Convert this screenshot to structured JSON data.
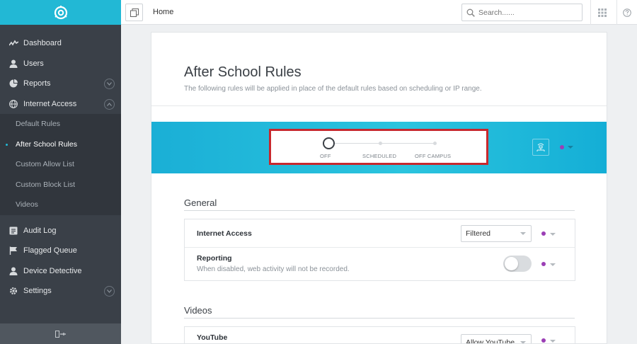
{
  "colors": {
    "brand": "#22b8d5",
    "sidebar": "#3a4048",
    "highlight_border": "#c8282d",
    "policy_dot": "#9b3fb5"
  },
  "sidebar": {
    "items": [
      {
        "label": "Dashboard",
        "icon": "activity-icon"
      },
      {
        "label": "Users",
        "icon": "user-icon"
      },
      {
        "label": "Reports",
        "icon": "pie-chart-icon"
      },
      {
        "label": "Internet Access",
        "icon": "globe-icon"
      }
    ],
    "sub_items": [
      {
        "label": "Default Rules"
      },
      {
        "label": "After School Rules"
      },
      {
        "label": "Custom Allow List"
      },
      {
        "label": "Custom Block List"
      },
      {
        "label": "Videos"
      }
    ],
    "items2": [
      {
        "label": "Audit Log",
        "icon": "list-icon"
      },
      {
        "label": "Flagged Queue",
        "icon": "flag-icon"
      },
      {
        "label": "Device Detective",
        "icon": "user-icon"
      },
      {
        "label": "Settings",
        "icon": "gear-icon"
      }
    ]
  },
  "topbar": {
    "breadcrumb": "Home",
    "search_placeholder": "Search......"
  },
  "page": {
    "title": "After School Rules",
    "description": "The following rules will be applied in place of the default rules based on scheduling or IP range."
  },
  "schedule": {
    "states": [
      "OFF",
      "SCHEDULED",
      "OFF CAMPUS"
    ],
    "selected": "OFF"
  },
  "general": {
    "title": "General",
    "internet_access": {
      "label": "Internet Access",
      "value": "Filtered"
    },
    "reporting": {
      "label": "Reporting",
      "description": "When disabled, web activity will not be recorded.",
      "enabled": false
    }
  },
  "videos": {
    "title": "Videos",
    "youtube": {
      "label": "YouTube",
      "value": "Allow YouTube"
    }
  }
}
